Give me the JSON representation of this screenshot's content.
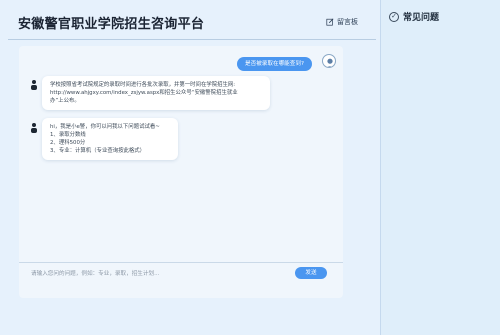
{
  "header": {
    "title": "安徽警官职业学院招生咨询平台",
    "guestbook_label": "留言板"
  },
  "faq": {
    "title": "常见问题"
  },
  "chat": {
    "messages": [
      {
        "role": "user",
        "text": "是否被录取在哪能查到?"
      },
      {
        "role": "bot",
        "lines": [
          "学校按照省考试院规定的录取时间进行各批次录取，并第一时间在学院招生网:",
          "http://www.ahjgxy.com/index_zsjyw.aspx和招生公众号“安徽警院招生就业",
          "办”上公布。"
        ]
      },
      {
        "role": "bot",
        "lines": [
          "hi，我是小e警，你可以问我以下问题试试看~",
          "1、录取分数线",
          "2、理科500分",
          "3、专业：计算机（专业查询按此格式）"
        ]
      }
    ]
  },
  "composer": {
    "placeholder": "请输入您问的问题，例如：专业，录取，招生计划...",
    "send_label": "发送"
  }
}
